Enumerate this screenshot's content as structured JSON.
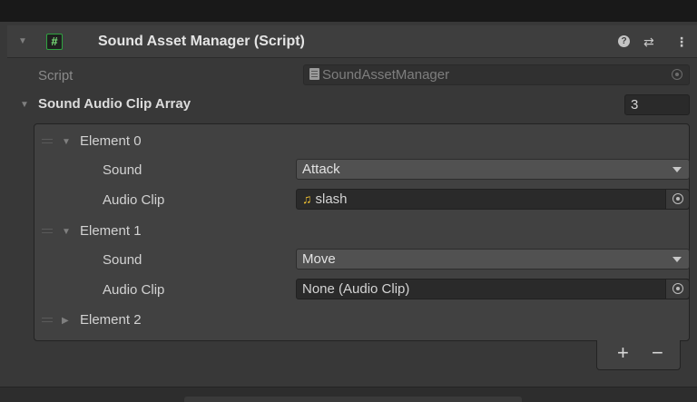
{
  "component": {
    "title": "Sound Asset Manager (Script)",
    "icon": "csharp-script-icon",
    "header_icons": [
      "help-icon",
      "preset-icon",
      "more-menu-icon"
    ],
    "help_glyph": "?",
    "preset_glyph": "⇄",
    "more_glyph": "⋮"
  },
  "script_field": {
    "label": "Script",
    "value": "SoundAssetManager"
  },
  "array": {
    "label": "Sound Audio Clip Array",
    "size": "3",
    "elements": [
      {
        "label": "Element 0",
        "expanded": true,
        "sound_label": "Sound",
        "sound_value": "Attack",
        "clip_label": "Audio Clip",
        "clip_value": "slash"
      },
      {
        "label": "Element 1",
        "expanded": true,
        "sound_label": "Sound",
        "sound_value": "Move",
        "clip_label": "Audio Clip",
        "clip_value": "None (Audio Clip)"
      },
      {
        "label": "Element 2",
        "expanded": false
      }
    ],
    "add_label": "+",
    "remove_label": "−"
  },
  "colors": {
    "background": "#383838",
    "field": "#2a2a2a",
    "dropdown": "#515151",
    "audio_icon": "#f1c232",
    "script_icon_border": "#2ea23f"
  }
}
